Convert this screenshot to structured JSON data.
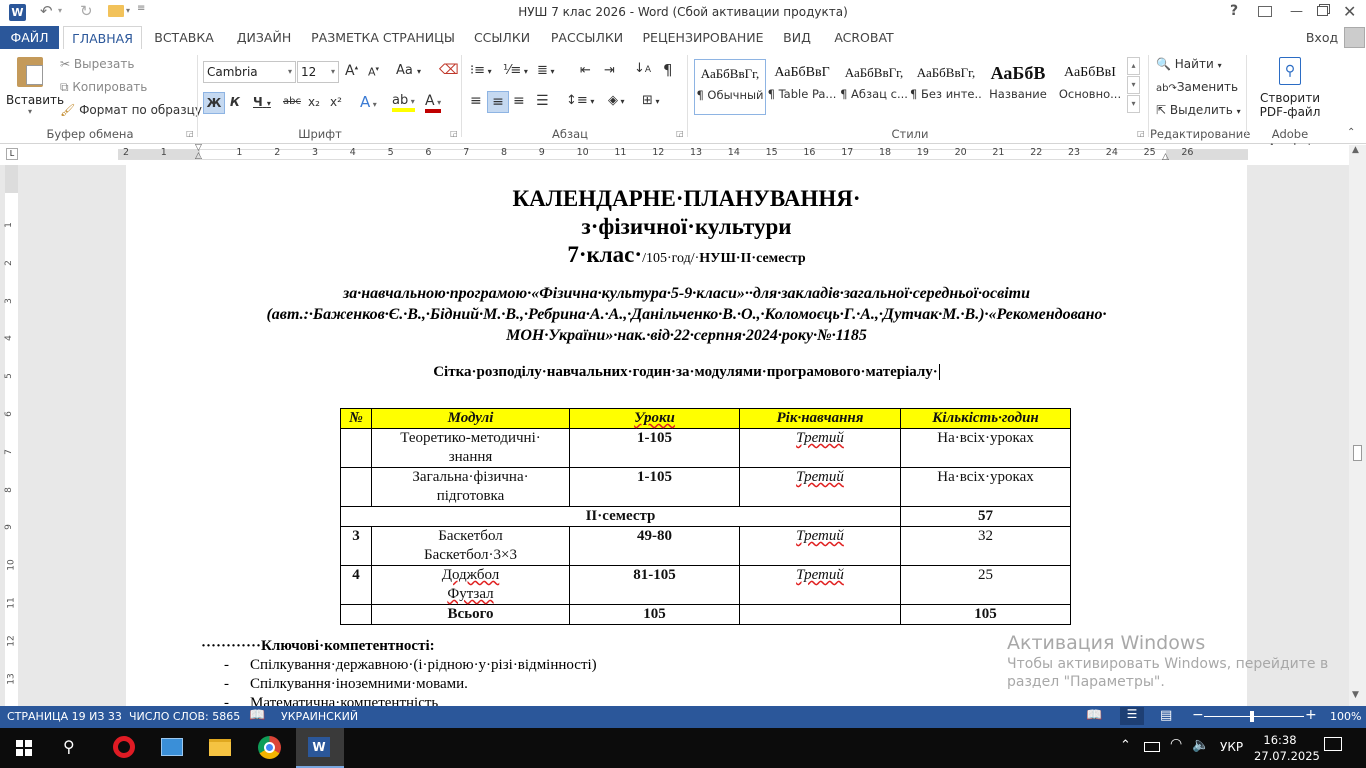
{
  "title_bar": {
    "doc_title": "НУШ 7 клас 2026 - Word (Сбой активации продукта)",
    "help": "?"
  },
  "tabs": [
    {
      "label": "ФАЙЛ"
    },
    {
      "label": "ГЛАВНАЯ"
    },
    {
      "label": "ВСТАВКА"
    },
    {
      "label": "ДИЗАЙН"
    },
    {
      "label": "РАЗМЕТКА СТРАНИЦЫ"
    },
    {
      "label": "ССЫЛКИ"
    },
    {
      "label": "РАССЫЛКИ"
    },
    {
      "label": "РЕЦЕНЗИРОВАНИЕ"
    },
    {
      "label": "ВИД"
    },
    {
      "label": "ACROBAT"
    }
  ],
  "sign_in": "Вход",
  "ribbon": {
    "clipboard": {
      "paste": "Вставить",
      "cut": "Вырезать",
      "copy": "Копировать",
      "format_painter": "Формат по образцу",
      "group": "Буфер обмена"
    },
    "font": {
      "name": "Cambria",
      "size": "12",
      "bold": "Ж",
      "italic": "К",
      "underline": "Ч",
      "strike": "abc",
      "sub": "x₂",
      "sup": "x²",
      "case": "Aa",
      "grow": "A",
      "shrink": "A",
      "group": "Шрифт"
    },
    "paragraph": {
      "group": "Абзац"
    },
    "styles": {
      "items": [
        {
          "sample": "АаБбВвГг,",
          "name": "¶ Обычный"
        },
        {
          "sample": "АаБбВвГ",
          "name": "¶ Table Pa..."
        },
        {
          "sample": "АаБбВвГг,",
          "name": "¶ Абзац с..."
        },
        {
          "sample": "АаБбВвГг,",
          "name": "¶ Без инте..."
        },
        {
          "sample": "АаБбВ",
          "name": "Название"
        },
        {
          "sample": "АаБбВвI",
          "name": "Основно..."
        }
      ],
      "group": "Стили"
    },
    "editing": {
      "find": "Найти",
      "replace": "Заменить",
      "select": "Выделить",
      "group": "Редактирование"
    },
    "acrobat": {
      "line1": "Створити",
      "line2": "PDF-файл",
      "group": "Adobe Acrobat"
    }
  },
  "ruler": {
    "h_numbers": [
      "2",
      "1",
      "1",
      "1",
      "2",
      "3",
      "4",
      "5",
      "6",
      "7",
      "8",
      "9",
      "10",
      "11",
      "12",
      "13",
      "14",
      "15",
      "16",
      "17",
      "18",
      "19",
      "20",
      "21",
      "22",
      "23",
      "24",
      "25",
      "26"
    ],
    "v_numbers": [
      "1",
      "2",
      "3",
      "4",
      "5",
      "6",
      "7",
      "8",
      "9",
      "10",
      "11",
      "12",
      "13"
    ]
  },
  "document": {
    "h1": "КАЛЕНДАРНЕ·ПЛАНУВАННЯ·",
    "h2": "з·фізичної·культури",
    "h3_big": "7·клас·",
    "h3_small": "/105·год/·",
    "h3_tail": "НУШ·ІІ·семестр",
    "program_line1": "за·навчальною·програмою·«Фізична·культура·5-9·класи»··для·закладів·загальної·середньої·освіти",
    "program_line2": "(авт.:·Баженков·Є.·В.,·Бідний·М.·В.,·Ребрина·А.·А.,·Данільченко·В.·О.,·Коломоєць·Г.·А.,·Дутчак·М.·В.)·«Рекомендовано·",
    "program_line3": "МОН·України»·нак.·від·22·серпня·2024·року·№·1185",
    "grid_title": "Сітка·розподілу·навчальних·годин·за·модулями·програмового·матеріалу·",
    "table": {
      "headers": [
        "№",
        "Модулі",
        "Уроки",
        "Рік·навчання",
        "Кількість·годин"
      ],
      "rows": [
        {
          "n": "",
          "module1": "Теоретико-методичні·",
          "module2": "знання",
          "lessons": "1-105",
          "year": "Третий",
          "hours": "На·всіх·уроках"
        },
        {
          "n": "",
          "module1": "Загальна·фізична·",
          "module2": "підготовка",
          "lessons": "1-105",
          "year": "Третий",
          "hours": "На·всіх·уроках"
        },
        {
          "n": "3",
          "module1": "Баскетбол",
          "module2": "Баскетбол·3×3",
          "lessons": "49-80",
          "year": "Третий",
          "hours": "32"
        },
        {
          "n": "4",
          "module1": "Доджбол",
          "module2": "Футзал",
          "lessons": "81-105",
          "year": "Третий",
          "hours": "25"
        }
      ],
      "semester_label": "ІІ·семестр",
      "semester_hours": "57",
      "total_label": "Всього",
      "total_lessons": "105",
      "total_hours": "105"
    },
    "competencies_title": "············Ключові·компетентності:",
    "bullets": [
      "Спілкування·державною·(і·рідною·у·різі·відмінності)",
      "Спілкування·іноземними·мовами.",
      "Математична·компетентність"
    ]
  },
  "watermark": {
    "line1": "Активация Windows",
    "line2": "Чтобы активировать Windows, перейдите в",
    "line3": "раздел \"Параметры\"."
  },
  "status": {
    "page": "СТРАНИЦА 19 ИЗ 33",
    "words": "ЧИСЛО СЛОВ: 5865",
    "lang": "УКРАИНСКИЙ",
    "zoom": "100%"
  },
  "taskbar": {
    "lang": "УКР",
    "time": "16:38",
    "date": "27.07.2025"
  },
  "colors": {
    "accent": "#2b579a",
    "header_fill": "#ffff00"
  }
}
